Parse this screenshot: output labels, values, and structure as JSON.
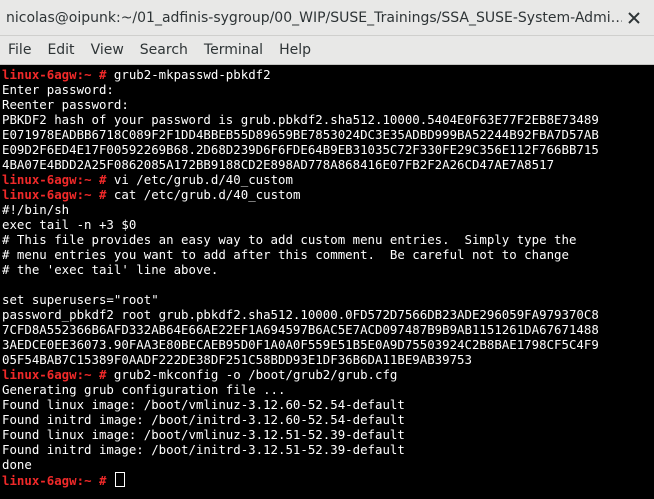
{
  "window": {
    "title": "nicolas@oipunk:~/01_adfinis-sygroup/00_WIP/SUSE_Trainings/SSA_SUSE-System-Admi…"
  },
  "menu": [
    "File",
    "Edit",
    "View",
    "Search",
    "Terminal",
    "Help"
  ],
  "prompt": {
    "host": "linux-6agw:",
    "symbol": "~ #"
  },
  "terminal_lines": [
    {
      "type": "cmd",
      "text": " grub2-mkpasswd-pbkdf2"
    },
    {
      "type": "out",
      "text": "Enter password:"
    },
    {
      "type": "out",
      "text": "Reenter password:"
    },
    {
      "type": "out",
      "text": "PBKDF2 hash of your password is grub.pbkdf2.sha512.10000.5404E0F63E77F2EB8E73489"
    },
    {
      "type": "out",
      "text": "E071978EADBB6718C089F2F1DD4BBEB55D89659BE7853024DC3E35ADBD999BA52244B92FBA7D57AB"
    },
    {
      "type": "out",
      "text": "E09D2F6ED4E17F00592269B68.2D68D239D6F6FDE64B9EB31035C72F330FE29C356E112F766BB715"
    },
    {
      "type": "out",
      "text": "4BA07E4BDD2A25F0862085A172BB9188CD2E898AD778A868416E07FB2F2A26CD47AE7A8517"
    },
    {
      "type": "cmd",
      "text": " vi /etc/grub.d/40_custom"
    },
    {
      "type": "cmd",
      "text": " cat /etc/grub.d/40_custom"
    },
    {
      "type": "out",
      "text": "#!/bin/sh"
    },
    {
      "type": "out",
      "text": "exec tail -n +3 $0"
    },
    {
      "type": "out",
      "text": "# This file provides an easy way to add custom menu entries.  Simply type the"
    },
    {
      "type": "out",
      "text": "# menu entries you want to add after this comment.  Be careful not to change"
    },
    {
      "type": "out",
      "text": "# the 'exec tail' line above."
    },
    {
      "type": "out",
      "text": ""
    },
    {
      "type": "out",
      "text": "set superusers=\"root\""
    },
    {
      "type": "out",
      "text": "password_pbkdf2 root grub.pbkdf2.sha512.10000.0FD572D7566DB23ADE296059FA979370C8"
    },
    {
      "type": "out",
      "text": "7CFD8A552366B6AFD332AB64E66AE22EF1A694597B6AC5E7ACD097487B9B9AB1151261DA67671488"
    },
    {
      "type": "out",
      "text": "3AEDCE0EE36073.90FAA3E80BECAEB95D0F1A0A0F559E51B5E0A9D75503924C2B8BAE1798CF5C4F9"
    },
    {
      "type": "out",
      "text": "05F54BAB7C15389F0AADF222DE38DF251C58BDD93E1DF36B6DA11BE9AB39753"
    },
    {
      "type": "cmd",
      "text": " grub2-mkconfig -o /boot/grub2/grub.cfg"
    },
    {
      "type": "out",
      "text": "Generating grub configuration file ..."
    },
    {
      "type": "out",
      "text": "Found linux image: /boot/vmlinuz-3.12.60-52.54-default"
    },
    {
      "type": "out",
      "text": "Found initrd image: /boot/initrd-3.12.60-52.54-default"
    },
    {
      "type": "out",
      "text": "Found linux image: /boot/vmlinuz-3.12.51-52.39-default"
    },
    {
      "type": "out",
      "text": "Found initrd image: /boot/initrd-3.12.51-52.39-default"
    },
    {
      "type": "out",
      "text": "done"
    },
    {
      "type": "cursor",
      "text": " "
    }
  ],
  "colors": {
    "prompt": "#ef2929",
    "text": "#ffffff",
    "background": "#000000"
  },
  "icons": {
    "close": "close-icon"
  }
}
